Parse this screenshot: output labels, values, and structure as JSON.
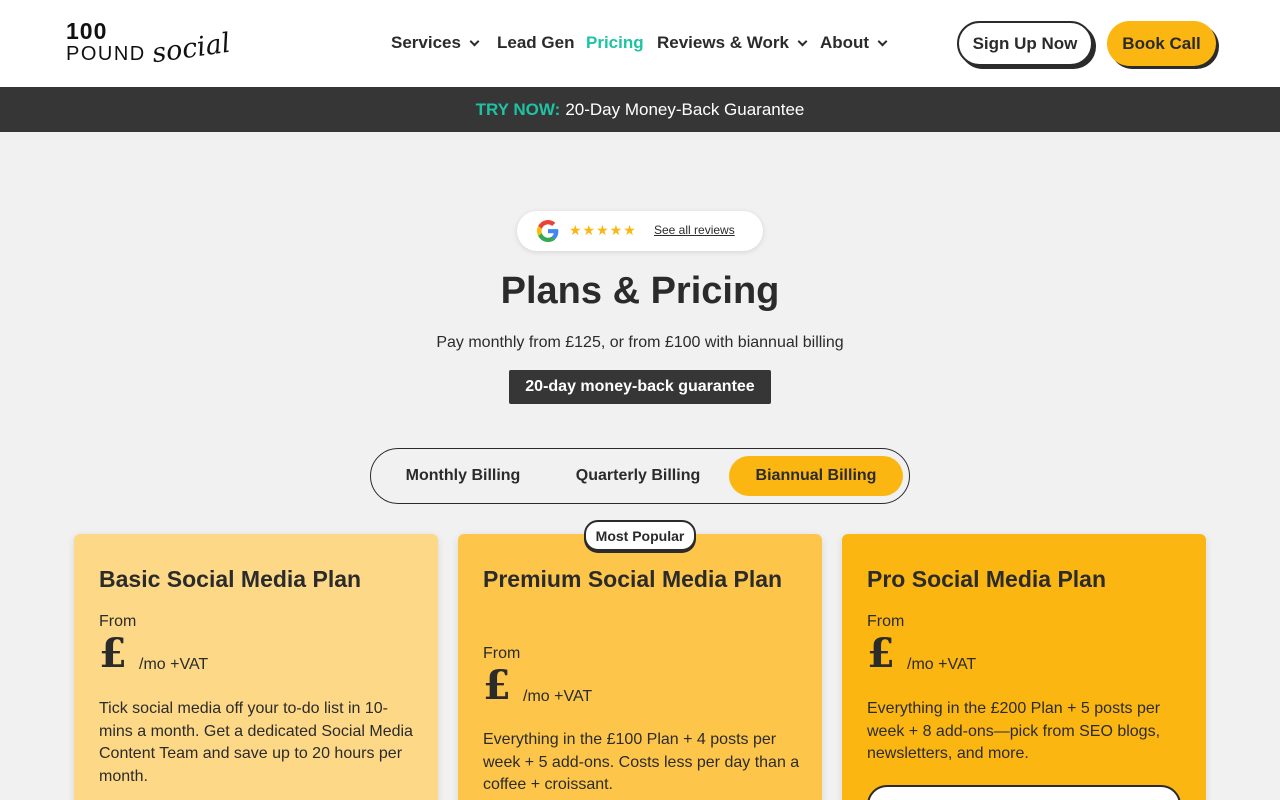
{
  "brand": {
    "logo_line1": "100",
    "logo_line2": "POUND",
    "logo_script": "social"
  },
  "nav": {
    "items": [
      {
        "label": "Services",
        "has_dropdown": true
      },
      {
        "label": "Lead Gen",
        "has_dropdown": false
      },
      {
        "label": "Pricing",
        "has_dropdown": false,
        "active": true
      },
      {
        "label": "Reviews & Work",
        "has_dropdown": true
      },
      {
        "label": "About",
        "has_dropdown": true
      }
    ],
    "signup_label": "Sign Up Now",
    "book_label": "Book Call"
  },
  "banner": {
    "highlight": "TRY NOW:",
    "text": "20-Day Money-Back Guarantee"
  },
  "reviews": {
    "stars": "★★★★★",
    "link_label": "See all reviews",
    "icon": "google-icon"
  },
  "hero": {
    "title": "Plans & Pricing",
    "subtitle": "Pay monthly from £125, or from £100 with biannual billing",
    "guarantee": "20-day money-back guarantee"
  },
  "billing": {
    "options": [
      "Monthly Billing",
      "Quarterly Billing",
      "Biannual Billing"
    ],
    "selected": "Biannual Billing"
  },
  "plans": [
    {
      "title": "Basic Social Media Plan",
      "from": "From",
      "currency": "£",
      "period": "/mo +VAT",
      "description": "Tick social media off your to-do list in 10-mins a month. Get a dedicated Social Media Content Team and save up to 20 hours per month.",
      "color": "#fdd886"
    },
    {
      "title": "Premium Social Media Plan",
      "from": "From",
      "currency": "£",
      "period": "/mo +VAT",
      "description": "Everything in the £100 Plan + 4 posts per week + 5 add-ons. Costs less per day than a coffee + croissant.",
      "badge": "Most Popular",
      "color": "#fdc64a"
    },
    {
      "title": "Pro Social Media Plan",
      "from": "From",
      "currency": "£",
      "period": "/mo +VAT",
      "description": "Everything in the £200 Plan + 5 posts per week + 8 add-ons—pick from SEO blogs, newsletters, and more.",
      "color": "#fbb612"
    }
  ],
  "colors": {
    "accent": "#fbb612",
    "teal": "#1ec3a3",
    "dark": "#363636",
    "page_bg": "#f1f1f1"
  }
}
